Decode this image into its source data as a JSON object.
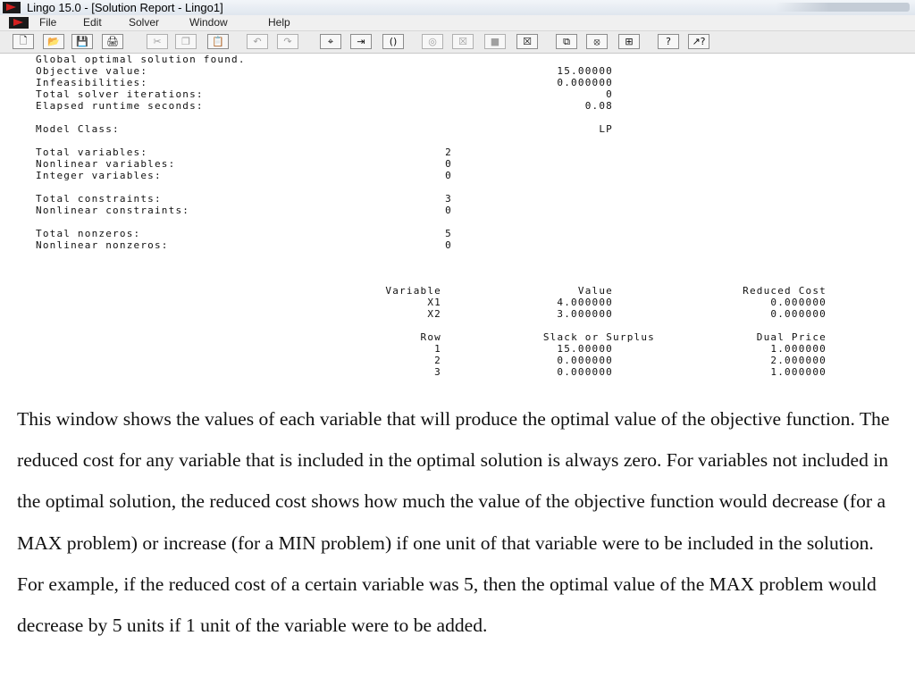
{
  "window": {
    "title": "Lingo 15.0 - [Solution Report - Lingo1]"
  },
  "menu": {
    "items": [
      "File",
      "Edit",
      "Solver",
      "Window",
      "Help"
    ]
  },
  "toolbar": {
    "buttons": [
      {
        "name": "new-file-icon",
        "glyph": "🗋"
      },
      {
        "name": "open-folder-icon",
        "glyph": "📂"
      },
      {
        "name": "save-icon",
        "glyph": "💾"
      },
      {
        "name": "print-icon",
        "glyph": "🖨"
      },
      {
        "name": "cut-icon",
        "glyph": "✂"
      },
      {
        "name": "copy-icon",
        "glyph": "❐"
      },
      {
        "name": "paste-icon",
        "glyph": "📋"
      },
      {
        "name": "undo-icon",
        "glyph": "↶"
      },
      {
        "name": "redo-icon",
        "glyph": "↷"
      },
      {
        "name": "find-icon",
        "glyph": "⌖"
      },
      {
        "name": "goto-line-icon",
        "glyph": "⇥"
      },
      {
        "name": "match-paren-icon",
        "glyph": "()"
      },
      {
        "name": "solve-icon",
        "glyph": "◎"
      },
      {
        "name": "solution-icon",
        "glyph": "☒"
      },
      {
        "name": "matrix-picture-icon",
        "glyph": "■"
      },
      {
        "name": "close-all-icon",
        "glyph": "☒"
      },
      {
        "name": "send-to-back-icon",
        "glyph": "⧉"
      },
      {
        "name": "close-window-icon",
        "glyph": "⦻"
      },
      {
        "name": "tile-icon",
        "glyph": "⊞"
      },
      {
        "name": "help-icon",
        "glyph": "?"
      },
      {
        "name": "context-help-icon",
        "glyph": "↗?"
      }
    ]
  },
  "report": {
    "status": "Global optimal solution found.",
    "summary": [
      {
        "label": "Objective value:",
        "value": "15.00000"
      },
      {
        "label": "Infeasibilities:",
        "value": "0.000000"
      },
      {
        "label": "Total solver iterations:",
        "value": "0"
      },
      {
        "label": "Elapsed runtime seconds:",
        "value": "0.08"
      }
    ],
    "model_class": {
      "label": "Model Class:",
      "value": "LP"
    },
    "variables": [
      {
        "label": "Total variables:",
        "value": "2"
      },
      {
        "label": "Nonlinear variables:",
        "value": "0"
      },
      {
        "label": "Integer variables:",
        "value": "0"
      }
    ],
    "constraints": [
      {
        "label": "Total constraints:",
        "value": "3"
      },
      {
        "label": "Nonlinear constraints:",
        "value": "0"
      }
    ],
    "nonzeros": [
      {
        "label": "Total nonzeros:",
        "value": "5"
      },
      {
        "label": "Nonlinear nonzeros:",
        "value": "0"
      }
    ],
    "var_table": {
      "headers": [
        "Variable",
        "Value",
        "Reduced Cost"
      ],
      "rows": [
        [
          "X1",
          "4.000000",
          "0.000000"
        ],
        [
          "X2",
          "3.000000",
          "0.000000"
        ]
      ]
    },
    "row_table": {
      "headers": [
        "Row",
        "Slack or Surplus",
        "Dual Price"
      ],
      "rows": [
        [
          "1",
          "15.00000",
          "1.000000"
        ],
        [
          "2",
          "0.000000",
          "2.000000"
        ],
        [
          "3",
          "0.000000",
          "1.000000"
        ]
      ]
    }
  },
  "explanation": "This window shows the values of each variable that will produce the optimal value of the objective function. The reduced cost for any variable that is included in the optimal solution is always zero. For variables not included in the optimal solution, the reduced cost shows how much the value of the objective function would decrease (for a MAX problem) or increase (for a MIN problem) if one unit of that variable were to be included in the solution. For example, if the reduced cost of a certain variable was 5, then the optimal value of the MAX problem would decrease by 5 units if 1 unit of the variable were to be added."
}
